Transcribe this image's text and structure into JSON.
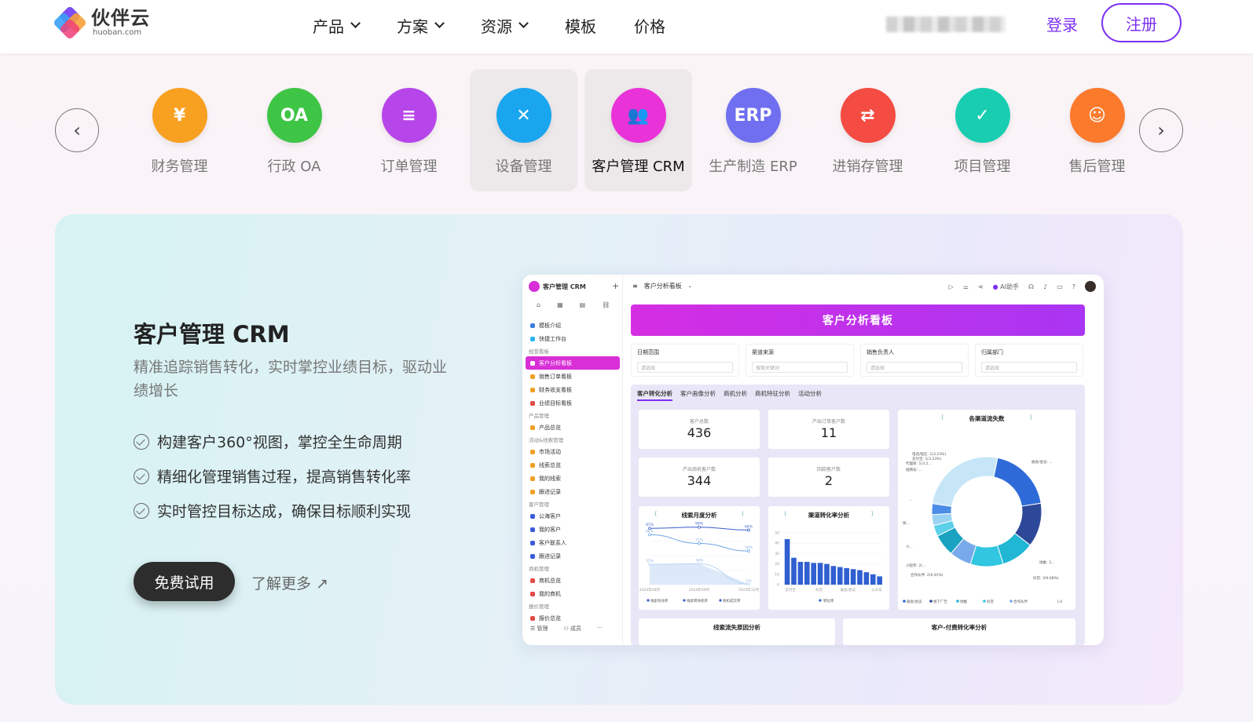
{
  "brand": {
    "name": "伙伴云",
    "domain": "huoban.com"
  },
  "nav": [
    {
      "label": "产品",
      "dropdown": true
    },
    {
      "label": "方案",
      "dropdown": true
    },
    {
      "label": "资源",
      "dropdown": true
    },
    {
      "label": "模板",
      "dropdown": false
    },
    {
      "label": "价格",
      "dropdown": false
    }
  ],
  "auth": {
    "login": "登录",
    "register": "注册"
  },
  "categories": [
    {
      "label": "财务管理",
      "icon": "money-bag-icon",
      "glyph": "¥",
      "color": "#f8a020"
    },
    {
      "label": "行政 OA",
      "icon": "oa-icon",
      "glyph": "OA",
      "color": "#3fc546"
    },
    {
      "label": "订单管理",
      "icon": "document-icon",
      "glyph": "≡",
      "color": "#b746ea"
    },
    {
      "label": "设备管理",
      "icon": "tools-icon",
      "glyph": "✕",
      "color": "#1aa6ef"
    },
    {
      "label": "客户管理 CRM",
      "icon": "users-icon",
      "glyph": "👥",
      "color": "#e932d8"
    },
    {
      "label": "生产制造 ERP",
      "icon": "erp-icon",
      "glyph": "ERP",
      "color": "#6f6ff0"
    },
    {
      "label": "进销存管理",
      "icon": "warehouse-icon",
      "glyph": "⇄",
      "color": "#f44b42"
    },
    {
      "label": "项目管理",
      "icon": "clipboard-check-icon",
      "glyph": "✓",
      "color": "#19cdb1"
    },
    {
      "label": "售后管理",
      "icon": "headset-icon",
      "glyph": "☺",
      "color": "#fb7a2c"
    }
  ],
  "hero": {
    "title": "客户管理 CRM",
    "subtitle": "精准追踪销售转化，实时掌控业绩目标，驱动业绩增长",
    "features": [
      "构建客户360°视图，掌控全生命周期",
      "精细化管理销售过程，提高销售转化率",
      "实时管控目标达成，确保目标顺利实现"
    ],
    "cta": "免费试用",
    "more": "了解更多 ↗"
  },
  "app": {
    "sidebar_title": "客户管理 CRM",
    "sidebar": [
      {
        "t": "item",
        "label": "模板介绍",
        "c": "#3b7ddd"
      },
      {
        "t": "item",
        "label": "快捷工作台",
        "c": "#2bb3f0"
      },
      {
        "t": "grp",
        "label": "经营看板"
      },
      {
        "t": "item",
        "label": "客户分析看板",
        "c": "#fff",
        "on": true
      },
      {
        "t": "item",
        "label": "销售订单看板",
        "c": "#f0a020"
      },
      {
        "t": "item",
        "label": "财务收支看板",
        "c": "#f0a020"
      },
      {
        "t": "item",
        "label": "业绩目标看板",
        "c": "#e34a4a"
      },
      {
        "t": "grp",
        "label": "产品管理"
      },
      {
        "t": "item",
        "label": "产品总览",
        "c": "#f0a020"
      },
      {
        "t": "grp",
        "label": "活动&线索管理"
      },
      {
        "t": "item",
        "label": "市场活动",
        "c": "#f0a020"
      },
      {
        "t": "item",
        "label": "线索总览",
        "c": "#f0a020"
      },
      {
        "t": "item",
        "label": "我的线索",
        "c": "#f0a020"
      },
      {
        "t": "item",
        "label": "跟进记录",
        "c": "#f0a020"
      },
      {
        "t": "grp",
        "label": "客户管理"
      },
      {
        "t": "item",
        "label": "公海客户",
        "c": "#3b5bd9"
      },
      {
        "t": "item",
        "label": "我的客户",
        "c": "#3b5bd9"
      },
      {
        "t": "item",
        "label": "客户联系人",
        "c": "#3b5bd9"
      },
      {
        "t": "item",
        "label": "跟进记录",
        "c": "#3b5bd9"
      },
      {
        "t": "grp",
        "label": "商机管理"
      },
      {
        "t": "item",
        "label": "商机总览",
        "c": "#e34a4a"
      },
      {
        "t": "item",
        "label": "我的商机",
        "c": "#e34a4a"
      },
      {
        "t": "grp",
        "label": "报价管理"
      },
      {
        "t": "item",
        "label": "报价总览",
        "c": "#e34a4a"
      }
    ],
    "sidebar_footer": [
      "☰ 管理",
      "⚇ 成员",
      "···"
    ],
    "breadcrumb": "客户分析看板",
    "ai": "AI助手",
    "banner": "客户分析看板",
    "filters": [
      {
        "label": "日期范围",
        "ph": "请选择"
      },
      {
        "label": "渠道来源",
        "ph": "搜索关键词"
      },
      {
        "label": "销售负责人",
        "ph": "请选择"
      },
      {
        "label": "归属部门",
        "ph": "请选择"
      }
    ],
    "tabs": [
      "客户转化分析",
      "客户画像分析",
      "商机分析",
      "商机特征分析",
      "活动分析"
    ],
    "kpis": [
      {
        "label": "客户总数",
        "value": "436"
      },
      {
        "label": "产出订单客户数",
        "value": "11"
      },
      {
        "label": "产出商机客户数",
        "value": "344"
      },
      {
        "label": "回款客户数",
        "value": "2"
      }
    ],
    "line_card": {
      "title": "线索月度分析",
      "legend": [
        "线索有效率",
        "线索转商机率",
        "商机成交率"
      ],
      "x": [
        "2024年08月",
        "2024年09月",
        "2024年12月"
      ],
      "labels": [
        "97%",
        "99%",
        "94%",
        "86%",
        "71%",
        "58%",
        "35%",
        "36%",
        "1%"
      ]
    },
    "bar_card": {
      "title": "渠道转化率分析",
      "legend": [
        "转化率"
      ],
      "x": [
        "支付宝",
        "抖音",
        "展会/会议",
        "公众号"
      ],
      "y": [
        "50",
        "40",
        "30",
        "20",
        "10",
        "0"
      ]
    },
    "pie_card": {
      "title": "各渠道流失数",
      "labels": [
        "电话/短信: 1(3.23%)",
        "支付宝: 1(3.23%)",
        "代理商: 1(3.2...",
        "短网号: ...",
        "展会/会议: ...",
        "小...",
        "小程序: 2(...",
        "合作伙伴: 2(6.45%)",
        "地推: 3...",
        "抖音: 3(9.68%)",
        "...",
        "快..."
      ],
      "legend": [
        "展会/会议",
        "线下广告",
        "地推",
        "抖音",
        "合作伙伴"
      ],
      "page": "1/4"
    },
    "bottom_cards": [
      "线索流失原因分析",
      "客户-付费转化率分析"
    ]
  },
  "chart_data": [
    {
      "type": "line",
      "title": "线索月度分析",
      "categories": [
        "2024年08月",
        "2024年09月",
        "2024年12月"
      ],
      "series": [
        {
          "name": "线索有效率",
          "values": [
            97,
            99,
            94
          ]
        },
        {
          "name": "线索转商机率",
          "values": [
            86,
            71,
            58
          ]
        },
        {
          "name": "商机成交率",
          "values": [
            35,
            36,
            1
          ]
        }
      ]
    },
    {
      "type": "bar",
      "title": "渠道转化率分析",
      "categories": [
        "支付宝",
        "抖音",
        "展会/会议",
        "公众号"
      ],
      "series": [
        {
          "name": "转化率",
          "values": [
            44,
            26,
            22,
            22,
            21,
            21,
            20,
            18,
            17,
            16,
            15,
            14,
            12,
            10,
            8
          ]
        }
      ],
      "ylim": [
        0,
        50
      ]
    },
    {
      "type": "pie",
      "title": "各渠道流失数",
      "values": [
        {
          "label": "展会/会议",
          "value": 6
        },
        {
          "label": "线下广告",
          "value": 4
        },
        {
          "label": "地推",
          "value": 3
        },
        {
          "label": "抖音",
          "value": 3
        },
        {
          "label": "合作伙伴",
          "value": 2
        },
        {
          "label": "小程序",
          "value": 2
        },
        {
          "label": "电话/短信",
          "value": 1
        },
        {
          "label": "支付宝",
          "value": 1
        },
        {
          "label": "代理商",
          "value": 1
        },
        {
          "label": "其他",
          "value": 8
        }
      ]
    }
  ]
}
